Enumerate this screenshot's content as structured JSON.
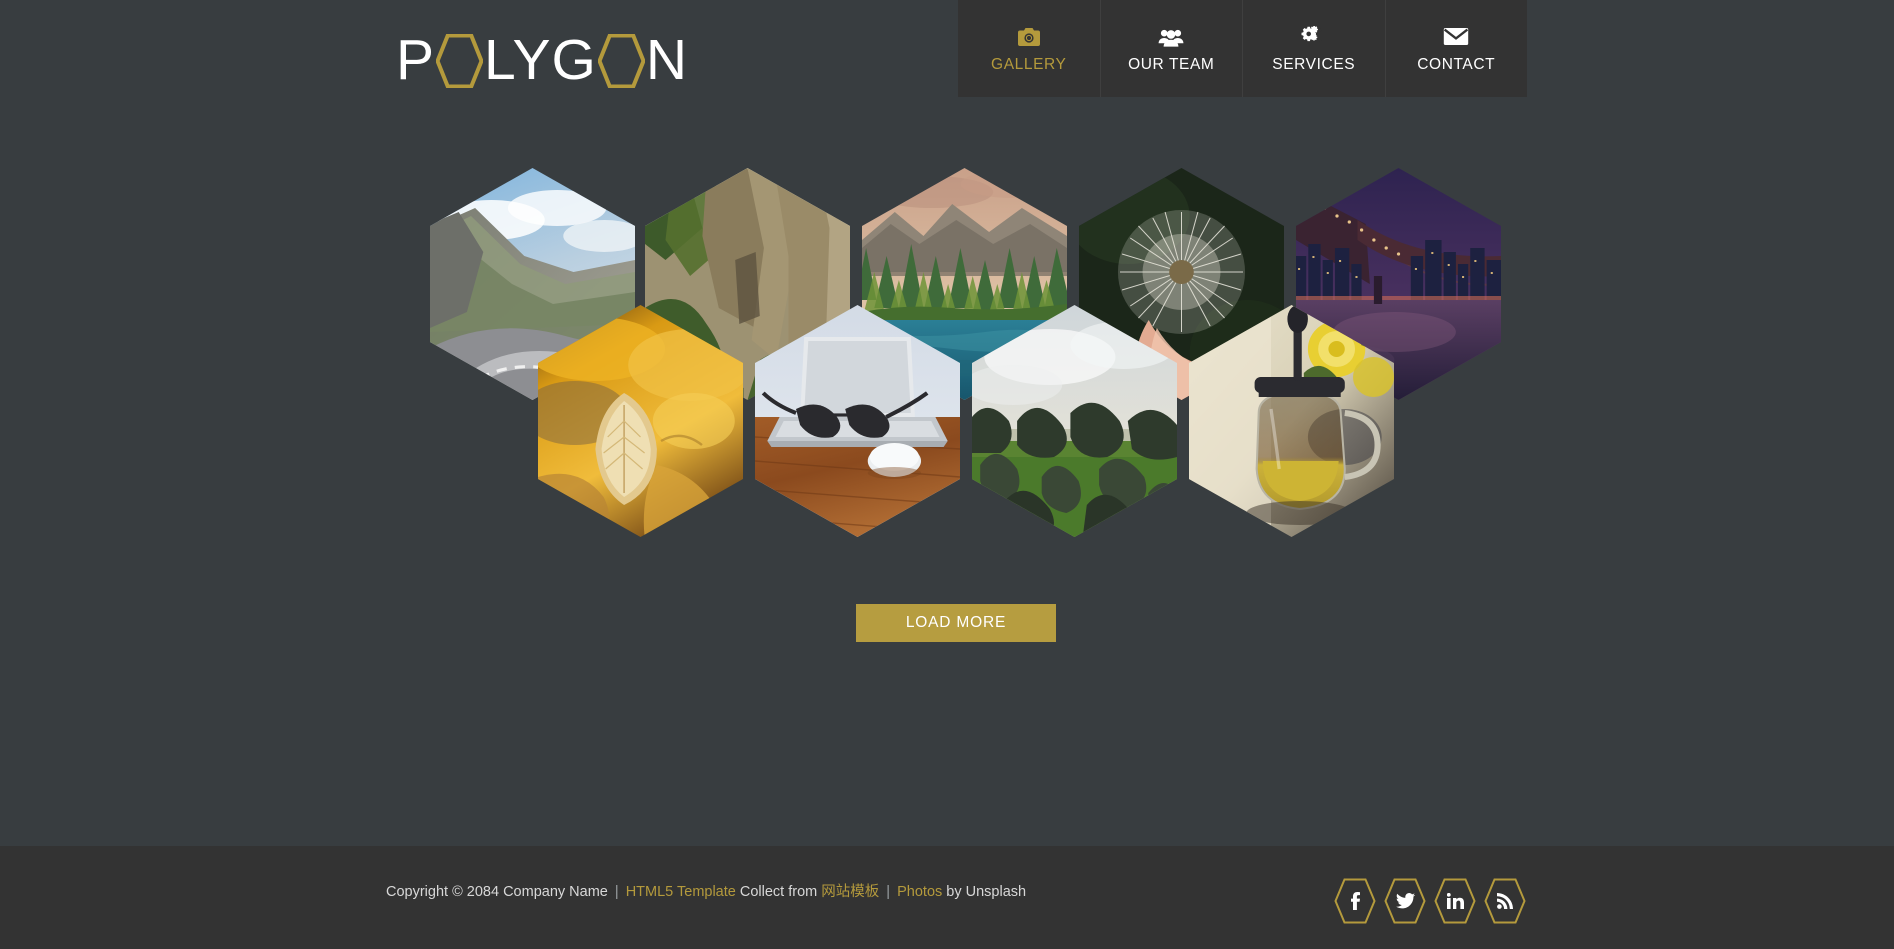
{
  "site": {
    "logo_text": "POLYGON",
    "logo_parts": [
      "P",
      "O",
      "LYG",
      "O",
      "N"
    ],
    "accent_gold": "#b49a3c",
    "button_gold": "#b69d40",
    "background": "#383d40",
    "bar_background": "#333333"
  },
  "nav": {
    "items": [
      {
        "label": "GALLERY",
        "icon": "camera-icon",
        "active": true
      },
      {
        "label": "OUR TEAM",
        "icon": "users-icon",
        "active": false
      },
      {
        "label": "SERVICES",
        "icon": "gears-icon",
        "active": false
      },
      {
        "label": "CONTACT",
        "icon": "envelope-icon",
        "active": false
      }
    ]
  },
  "gallery": {
    "rows": [
      {
        "row": 1,
        "tiles": [
          {
            "caption": "mountain road through alpine cliffs",
            "palette": [
              "#8fb8d8",
              "#6f7a6a",
              "#9b9d9e",
              "#4e5b4a"
            ]
          },
          {
            "caption": "sandstone rock formations with trees",
            "palette": [
              "#8c7f63",
              "#4d5c36",
              "#b0a182",
              "#6a6447"
            ]
          },
          {
            "caption": "pine forest lake with mountain range",
            "palette": [
              "#c9a98e",
              "#6f8a4a",
              "#2e7f92",
              "#3f6b42"
            ]
          },
          {
            "caption": "hand holding a dandelion seed head",
            "palette": [
              "#1d2a1d",
              "#e8e4dc",
              "#e9b9a4",
              "#2c3a28"
            ]
          },
          {
            "caption": "brooklyn bridge city skyline at night",
            "palette": [
              "#3a2d57",
              "#6b4668",
              "#2b2342",
              "#8e5d73"
            ]
          }
        ]
      },
      {
        "row": 2,
        "tiles": [
          {
            "caption": "dried golden leaves close-up",
            "palette": [
              "#d79b1e",
              "#8a5a1a",
              "#e9c166",
              "#54381a"
            ]
          },
          {
            "caption": "laptop, glasses and mouse on wood desk",
            "palette": [
              "#cfd8e4",
              "#e6e8ea",
              "#8b4a23",
              "#a0683a"
            ]
          },
          {
            "caption": "dark boulders on green grass field",
            "palette": [
              "#c9cfd2",
              "#2f3a31",
              "#4f7a33",
              "#243024"
            ]
          },
          {
            "caption": "glass teapot with yellow roses",
            "palette": [
              "#e3d9c2",
              "#d9c23a",
              "#4a3a2c",
              "#c9b44e"
            ]
          }
        ]
      }
    ]
  },
  "load_more": {
    "label": "LOAD MORE"
  },
  "footer": {
    "copyright_prefix": "Copyright © 2084 Company Name",
    "sep1": "|",
    "link_html5": "HTML5 Template",
    "collect_from": "Collect from",
    "link_cn": "网站模板",
    "sep2": "|",
    "link_photos": "Photos",
    "by_unsplash": "by Unsplash",
    "social": [
      {
        "name": "facebook",
        "glyph": "f"
      },
      {
        "name": "twitter",
        "glyph": "t"
      },
      {
        "name": "linkedin",
        "glyph": "in"
      },
      {
        "name": "rss",
        "glyph": "rss"
      }
    ]
  }
}
